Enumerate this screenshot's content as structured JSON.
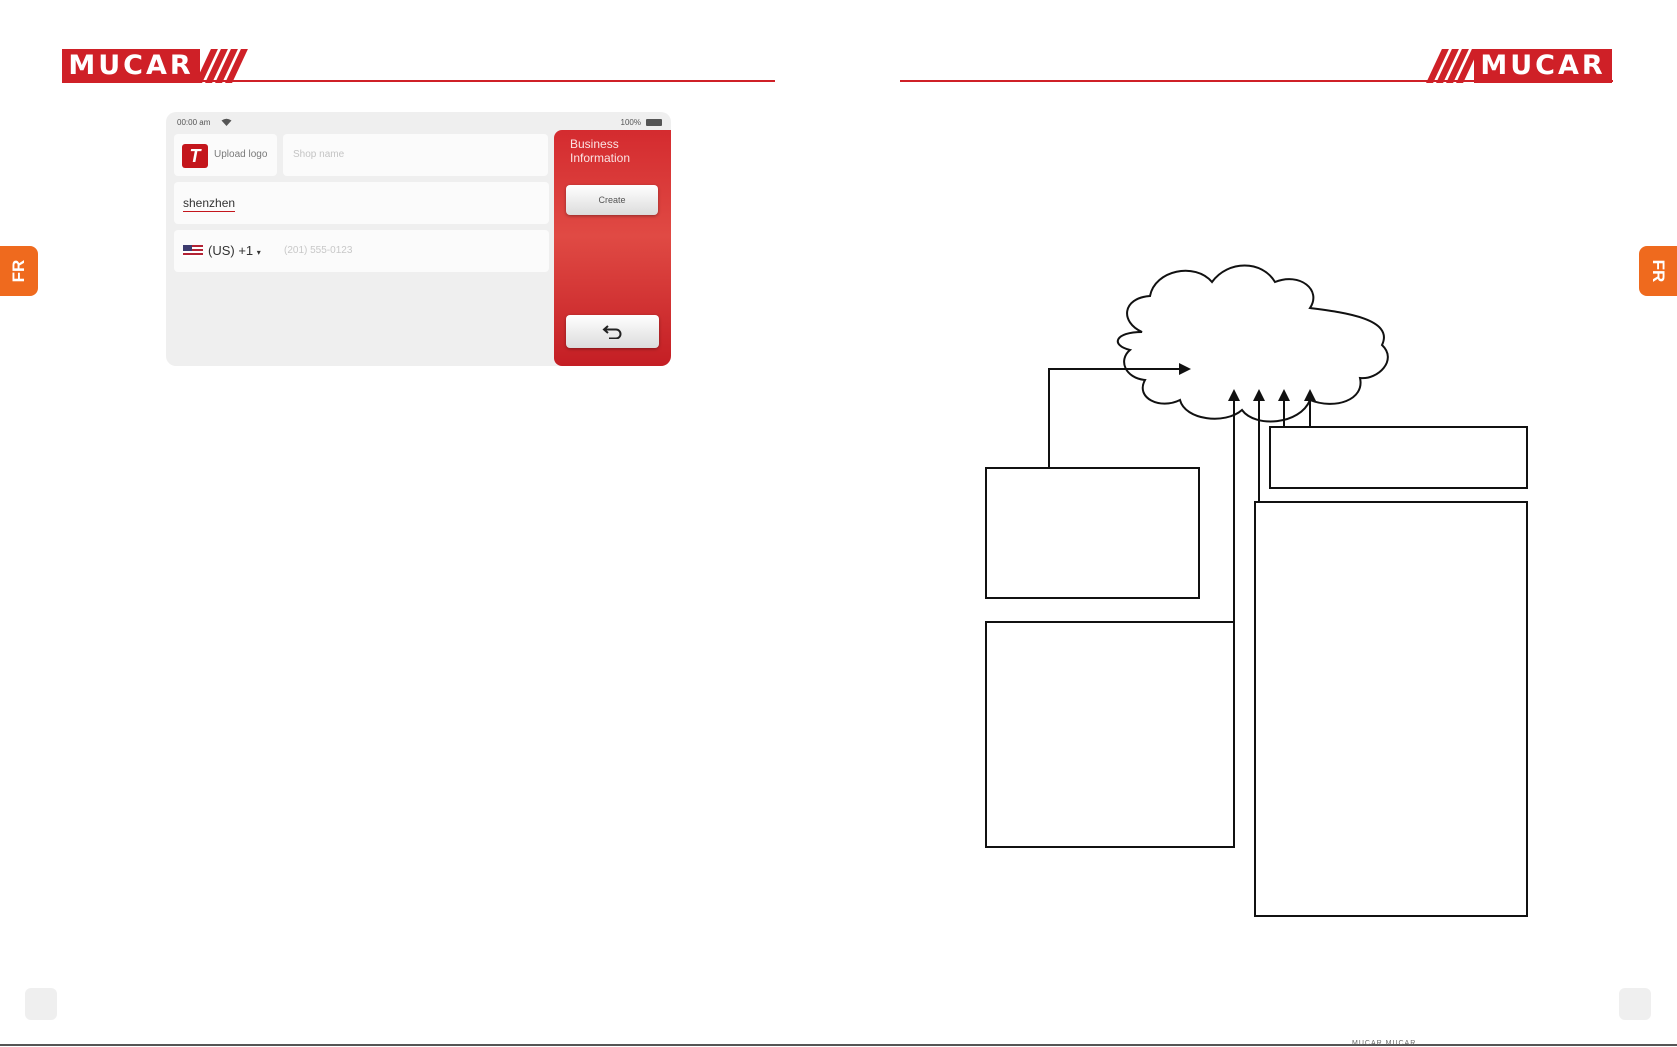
{
  "brand": {
    "logo_text": "MUCAR",
    "accent_color": "#cf2027"
  },
  "side_tabs": {
    "left": "FR",
    "right": "FR",
    "color": "#ef6a1e"
  },
  "tablet": {
    "status_time": "00:00 am",
    "battery": "100%",
    "upload_logo_label": "Upload logo",
    "shop_name_placeholder": "Shop name",
    "address_value": "shenzhen",
    "country_code": "(US) +1",
    "phone_placeholder": "(201) 555-0123",
    "panel_title": "Business Information",
    "create_label": "Create",
    "panel_color": "#d42b2f",
    "icons": [
      "wifi-icon",
      "battery-icon",
      "logo-mark-icon",
      "flag-us-icon",
      "dropdown-arrow-icon",
      "back-arrow-icon"
    ]
  },
  "diagram": {
    "shapes": [
      "cloud",
      "box",
      "box",
      "box",
      "box"
    ],
    "connectors": 5
  },
  "footer": {
    "text": "MUCAR MUCAR"
  }
}
